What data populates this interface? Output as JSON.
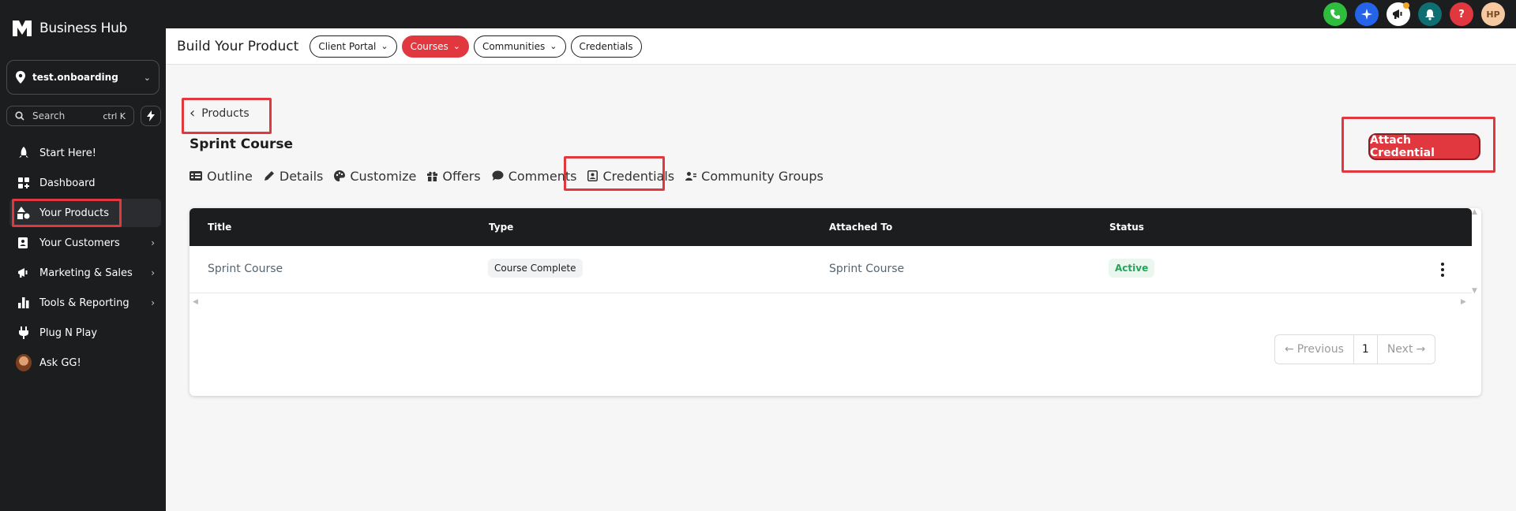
{
  "brand": {
    "name": "Business Hub"
  },
  "account": {
    "name": "test.onboarding"
  },
  "search": {
    "label": "Search",
    "shortcut": "ctrl K"
  },
  "sidebar": {
    "items": [
      {
        "label": "Start Here!",
        "icon": "rocket-icon"
      },
      {
        "label": "Dashboard",
        "icon": "dashboard-icon"
      },
      {
        "label": "Your Products",
        "icon": "shapes-icon"
      },
      {
        "label": "Your Customers",
        "icon": "contact-card-icon"
      },
      {
        "label": "Marketing & Sales",
        "icon": "megaphone-icon"
      },
      {
        "label": "Tools & Reporting",
        "icon": "bar-chart-icon"
      },
      {
        "label": "Plug N Play",
        "icon": "plug-icon"
      },
      {
        "label": "Ask GG!",
        "icon": "avatar-icon"
      }
    ]
  },
  "topbar": {
    "avatar_initials": "HP",
    "colors": {
      "phone": "#2ebd3c",
      "ai": "#2563eb",
      "notify": "#0f6e72",
      "help": "#e0383e",
      "avatar": "#f7c9a0"
    }
  },
  "subheader": {
    "title": "Build Your Product",
    "pills": [
      "Client Portal",
      "Courses",
      "Communities",
      "Credentials"
    ]
  },
  "main": {
    "back_label": "Products",
    "title": "Sprint Course",
    "attach_button": "Attach Credential",
    "tabs": [
      "Outline",
      "Details",
      "Customize",
      "Offers",
      "Comments",
      "Credentials",
      "Community Groups"
    ]
  },
  "table": {
    "headers": [
      "Title",
      "Type",
      "Attached To",
      "Status"
    ],
    "rows": [
      {
        "title": "Sprint Course",
        "type": "Course Complete",
        "attached_to": "Sprint Course",
        "status": "Active"
      }
    ]
  },
  "pagination": {
    "previous": "Previous",
    "page": "1",
    "next": "Next"
  },
  "accent_color": "#e0383e"
}
